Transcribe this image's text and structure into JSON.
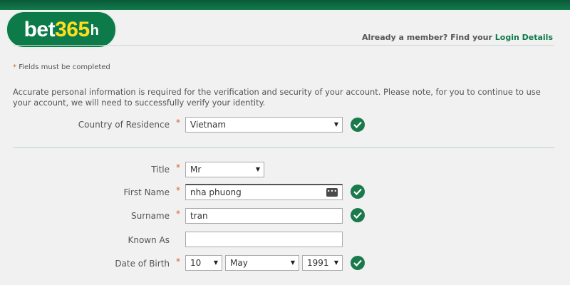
{
  "brand": {
    "bet": "bet",
    "num": "365",
    "suffix": "h"
  },
  "header": {
    "member_prompt": "Already a member? Find your",
    "login_link": "Login Details"
  },
  "form": {
    "required_star": "*",
    "required_note": "Fields must be completed",
    "intro": "Accurate personal information is required for the verification and security of your account. Please note, for you to continue to use your account, we will need to successfully verify your identity.",
    "country": {
      "label": "Country of Residence",
      "value": "Vietnam"
    },
    "title": {
      "label": "Title",
      "value": "Mr"
    },
    "first_name": {
      "label": "First Name",
      "value": "nha phuong"
    },
    "surname": {
      "label": "Surname",
      "value": "tran"
    },
    "known_as": {
      "label": "Known As",
      "value": ""
    },
    "dob": {
      "label": "Date of Birth",
      "day": "10",
      "month": "May",
      "year": "1991"
    }
  },
  "colors": {
    "brand_green": "#0d7a4a",
    "brand_yellow": "#ffdf1b",
    "required": "#d0682a",
    "check": "#1a7a4b"
  }
}
